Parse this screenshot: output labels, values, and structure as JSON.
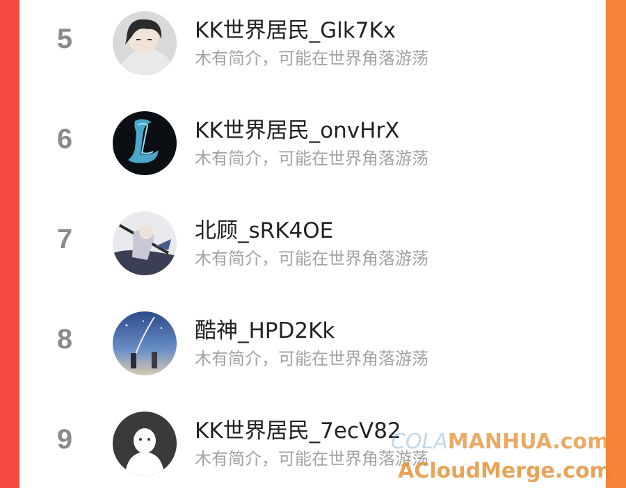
{
  "users": [
    {
      "rank": "5",
      "name": "KK世界居民_Glk7Kx",
      "bio": "木有简介，可能在世界角落游荡",
      "avatar": "anime-boy-avatar-icon"
    },
    {
      "rank": "6",
      "name": "KK世界居民_onvHrX",
      "bio": "木有简介，可能在世界角落游荡",
      "avatar": "letter-l-avatar-icon"
    },
    {
      "rank": "7",
      "name": "北顾_sRK4OE",
      "bio": "木有简介，可能在世界角落游荡",
      "avatar": "anime-warrior-avatar-icon"
    },
    {
      "rank": "8",
      "name": "酷神_HPD2Kk",
      "bio": "木有简介，可能在世界角落游荡",
      "avatar": "starry-sky-avatar-icon"
    },
    {
      "rank": "9",
      "name": "KK世界居民_7ecV82",
      "bio": "木有简介，可能在世界角落游荡",
      "avatar": "default-ghost-avatar-icon"
    }
  ],
  "watermark": {
    "line1_prefix": "COLA",
    "line1_main": "MANHUA.com",
    "line2": "ACloudMerge.com"
  }
}
